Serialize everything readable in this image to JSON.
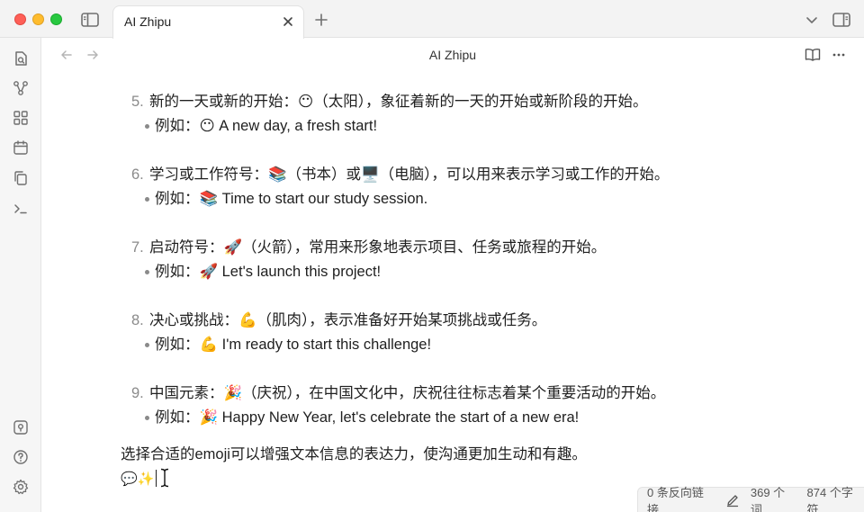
{
  "tab": {
    "title": "AI Zhipu"
  },
  "view": {
    "title": "AI Zhipu"
  },
  "items": [
    {
      "num": "5.",
      "text": "新的一天或新的开始：😶（太阳），象征着新的一天的开始或新阶段的开始。",
      "example": "例如：😶 A new day, a fresh start!"
    },
    {
      "num": "6.",
      "text": "学习或工作符号：📚（书本）或🖥️（电脑），可以用来表示学习或工作的开始。",
      "example": "例如：📚 Time to start our study session."
    },
    {
      "num": "7.",
      "text": "启动符号：🚀（火箭），常用来形象地表示项目、任务或旅程的开始。",
      "example": "例如：🚀 Let's launch this project!"
    },
    {
      "num": "8.",
      "text": "决心或挑战：💪（肌肉），表示准备好开始某项挑战或任务。",
      "example": "例如：💪 I'm ready to start this challenge!"
    },
    {
      "num": "9.",
      "text": "中国元素：🎉（庆祝），在中国文化中，庆祝往往标志着某个重要活动的开始。",
      "example": "例如：🎉 Happy New Year, let's celebrate the start of a new era!"
    }
  ],
  "paragraph": "选择合适的emoji可以增强文本信息的表达力，使沟通更加生动和有趣。",
  "last_line": "💬✨",
  "status": {
    "backlinks": "0 条反向链接",
    "words": "369 个词",
    "chars": "874 个字符"
  },
  "icons": {
    "left_sidebar_toggle": "sidebar-icon",
    "new_tab": "plus-icon",
    "tab_close": "close-icon",
    "tab_list": "chevron-down-icon",
    "right_sidebar_toggle": "sidebar-right-icon",
    "ribbon": [
      "file-search-icon",
      "graph-icon",
      "canvas-grid-icon",
      "calendar-icon",
      "copy-files-icon",
      "terminal-icon",
      "vault-icon",
      "help-icon",
      "settings-icon"
    ],
    "nav": [
      "arrow-left-icon",
      "arrow-right-icon"
    ],
    "view_actions": [
      "book-open-icon",
      "more-horizontal-icon"
    ],
    "status": [
      "pen-icon"
    ]
  }
}
